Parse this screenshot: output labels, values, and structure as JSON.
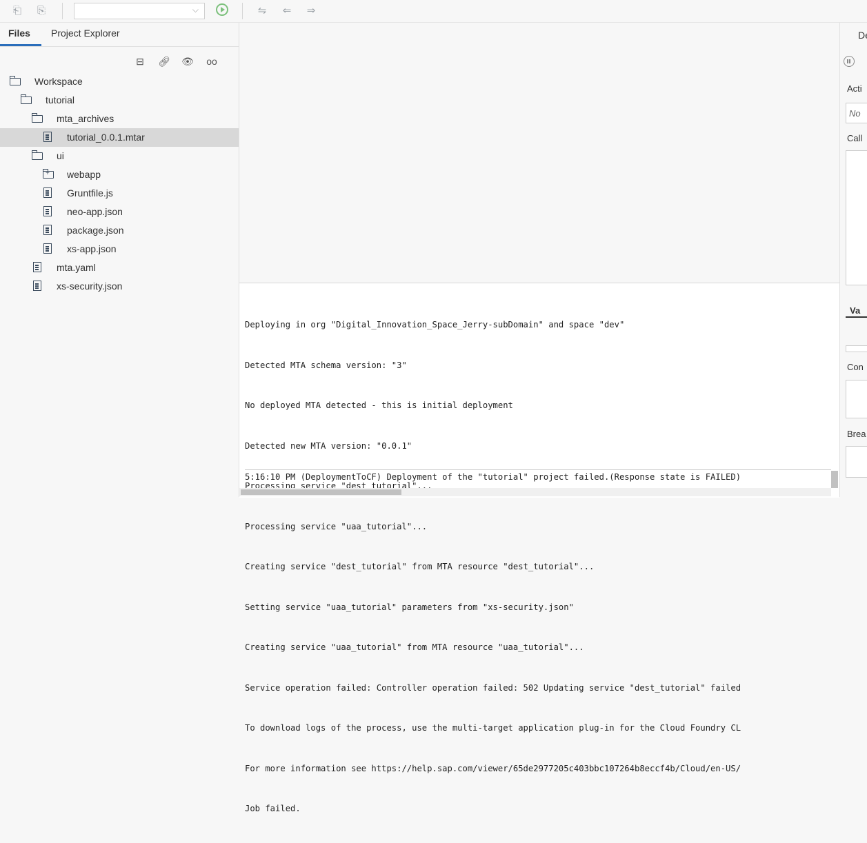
{
  "toolbar": {
    "build_selector_value": "",
    "icons": [
      "collapse-icon",
      "expand-icon",
      "chevron-down-icon",
      "run-icon",
      "compare-icon",
      "back-icon",
      "forward-icon"
    ]
  },
  "left_panel": {
    "tabs": [
      {
        "label": "Files",
        "active": true
      },
      {
        "label": "Project Explorer",
        "active": false
      }
    ],
    "tree": [
      {
        "label": "Workspace",
        "type": "folder",
        "depth": 0
      },
      {
        "label": "tutorial",
        "type": "folder",
        "depth": 1
      },
      {
        "label": "mta_archives",
        "type": "folder",
        "depth": 2
      },
      {
        "label": "tutorial_0.0.1.mtar",
        "type": "file",
        "depth": 3,
        "selected": true
      },
      {
        "label": "ui",
        "type": "folder",
        "depth": 2
      },
      {
        "label": "webapp",
        "type": "package",
        "depth": 3
      },
      {
        "label": "Gruntfile.js",
        "type": "file",
        "depth": 3
      },
      {
        "label": "neo-app.json",
        "type": "file",
        "depth": 3
      },
      {
        "label": "package.json",
        "type": "file",
        "depth": 3
      },
      {
        "label": "xs-app.json",
        "type": "file",
        "depth": 3
      },
      {
        "label": "mta.yaml",
        "type": "file",
        "depth": 2
      },
      {
        "label": "xs-security.json",
        "type": "file",
        "depth": 2
      }
    ]
  },
  "console": {
    "lines": [
      "Deploying in org \"Digital_Innovation_Space_Jerry-subDomain\" and space \"dev\"",
      "Detected MTA schema version: \"3\"",
      "No deployed MTA detected - this is initial deployment",
      "Detected new MTA version: \"0.0.1\"",
      "Processing service \"dest_tutorial\"...",
      "Processing service \"uaa_tutorial\"...",
      "Creating service \"dest_tutorial\" from MTA resource \"dest_tutorial\"...",
      "Setting service \"uaa_tutorial\" parameters from \"xs-security.json\"",
      "Creating service \"uaa_tutorial\" from MTA resource \"uaa_tutorial\"...",
      "Service operation failed: Controller operation failed: 502 Updating service \"dest_tutorial\" failed",
      "To download logs of the process, use the multi-target application plug-in for the Cloud Foundry CL",
      "For more information see https://help.sap.com/viewer/65de2977205c403bbc107264b8eccf4b/Cloud/en-US/",
      "Job failed."
    ],
    "last_message": "5:16:10 PM (DeploymentToCF) Deployment of the \"tutorial\" project failed.(Response state is FAILED)"
  },
  "right_panel": {
    "tab_label": "De",
    "activity_label": "Acti",
    "activity_value": "No",
    "call_label": "Call",
    "variables_tab": "Va",
    "console_label": "Con",
    "breakpoints_label": "Brea"
  }
}
